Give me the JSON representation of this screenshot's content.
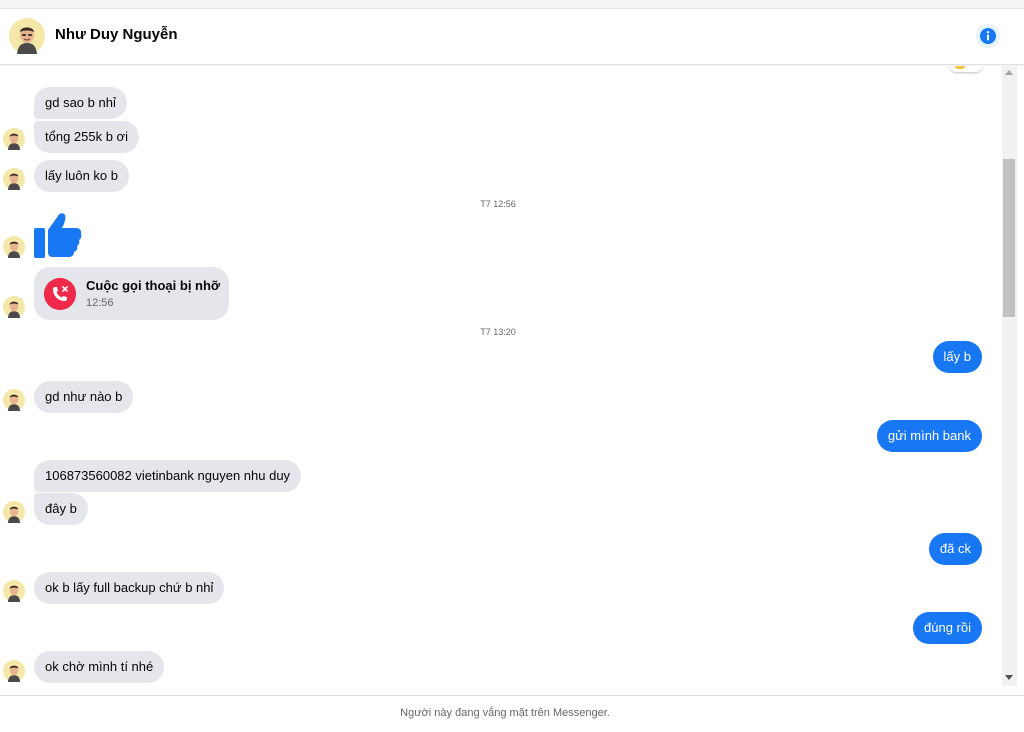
{
  "header": {
    "contact_name": "Như Duy Nguyễn"
  },
  "icons": {
    "info": "info-icon",
    "like": "thumbs-up-icon",
    "missed_call": "missed-call-icon",
    "avatar": "avatar"
  },
  "colors": {
    "outgoing_bubble": "#1877f2",
    "incoming_bubble": "#e4e6eb",
    "missed_call": "#f02849"
  },
  "messages": [
    {
      "from": "contact",
      "text": "gd sao b nhỉ"
    },
    {
      "from": "contact",
      "text": "tổng 255k b ơi"
    },
    {
      "from": "contact",
      "text": "lấy luôn ko b"
    },
    {
      "type": "timestamp",
      "text": "T7 12:56"
    },
    {
      "from": "contact",
      "type": "like"
    },
    {
      "from": "contact",
      "type": "call",
      "title": "Cuộc gọi thoại bị nhỡ",
      "time": "12:56"
    },
    {
      "type": "timestamp",
      "text": "T7 13:20"
    },
    {
      "from": "me",
      "text": "lấy b"
    },
    {
      "from": "contact",
      "text": "gd như nào b"
    },
    {
      "from": "me",
      "text": "gửi mình bank"
    },
    {
      "from": "contact",
      "text": "106873560082 vietinbank nguyen nhu duy"
    },
    {
      "from": "contact",
      "text": "đây b"
    },
    {
      "from": "me",
      "text": "đã ck"
    },
    {
      "from": "contact",
      "text": "ok b lấy full backup chứ b nhỉ"
    },
    {
      "from": "me",
      "text": "đúng rồi"
    },
    {
      "from": "contact",
      "text": "ok chờ mình tí nhé"
    }
  ],
  "footer": {
    "status_text": "Người này đang vắng mặt trên Messenger."
  }
}
